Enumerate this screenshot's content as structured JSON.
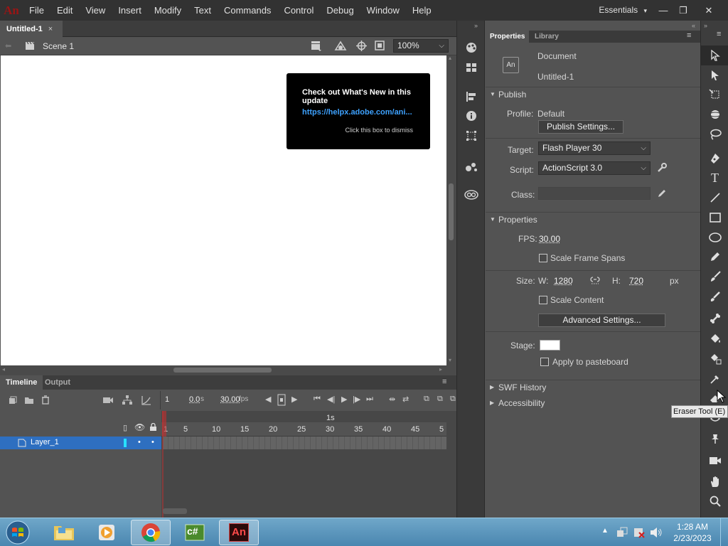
{
  "menubar": {
    "logo": "An",
    "items": [
      "File",
      "Edit",
      "View",
      "Insert",
      "Modify",
      "Text",
      "Commands",
      "Control",
      "Debug",
      "Window",
      "Help"
    ],
    "workspace": "Essentials"
  },
  "doc_tab": {
    "title": "Untitled-1",
    "close": "×"
  },
  "scene": {
    "name": "Scene 1",
    "zoom": "100%"
  },
  "popup": {
    "title": "Check out What's New in this update",
    "link": "https://helpx.adobe.com/ani...",
    "dismiss": "Click this box to dismiss"
  },
  "timeline": {
    "tabs": [
      "Timeline",
      "Output"
    ],
    "frame": "1",
    "time": "0.0",
    "time_unit": "s",
    "fps": "30.00",
    "fps_unit": "fps",
    "ruler_marks": [
      "1",
      "5",
      "10",
      "15",
      "20",
      "25",
      "30",
      "35",
      "40",
      "45",
      "5"
    ],
    "second_label": "1s",
    "layer_name": "Layer_1"
  },
  "properties": {
    "tabs": [
      "Properties",
      "Library"
    ],
    "doc_icon": "An",
    "doc_type": "Document",
    "doc_name": "Untitled-1",
    "publish": {
      "header": "Publish",
      "profile_label": "Profile:",
      "profile_value": "Default",
      "settings_button": "Publish Settings...",
      "target_label": "Target:",
      "target_value": "Flash Player 30",
      "script_label": "Script:",
      "script_value": "ActionScript 3.0",
      "class_label": "Class:",
      "class_value": ""
    },
    "props": {
      "header": "Properties",
      "fps_label": "FPS:",
      "fps_value": "30.00",
      "scale_spans": "Scale Frame Spans",
      "size_label": "Size:",
      "w_label": "W:",
      "w_value": "1280",
      "h_label": "H:",
      "h_value": "720",
      "unit": "px",
      "scale_content": "Scale Content",
      "advanced_button": "Advanced Settings...",
      "stage_label": "Stage:",
      "stage_color": "#ffffff",
      "pasteboard": "Apply to pasteboard"
    },
    "swf_history": "SWF History",
    "accessibility": "Accessibility"
  },
  "tooltip": "Eraser Tool (E)",
  "taskbar": {
    "time": "1:28 AM",
    "date": "2/23/2023",
    "an_label": "An",
    "cs_label": "c#"
  },
  "colors": {
    "accent": "#2e6fc0",
    "logo_red": "#9a1515",
    "link": "#3ea2ff"
  }
}
